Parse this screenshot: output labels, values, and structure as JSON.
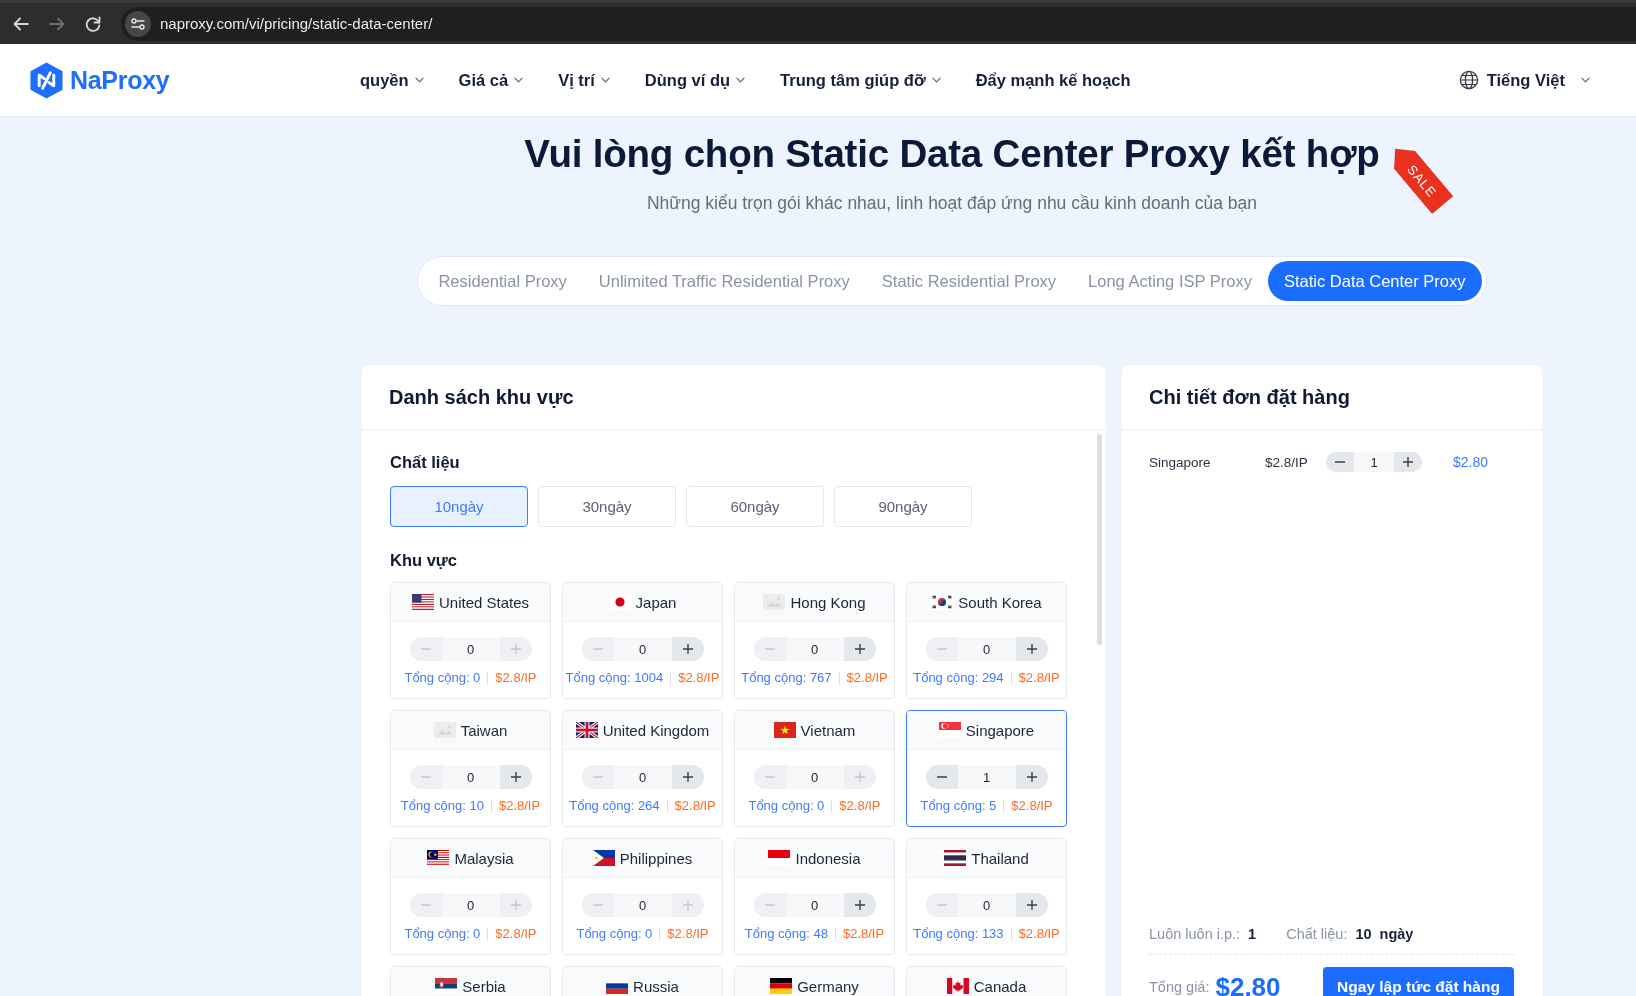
{
  "browser": {
    "nav_buttons": [
      {
        "kind": "back",
        "disabled": false
      },
      {
        "kind": "forward",
        "disabled": true
      },
      {
        "kind": "reload",
        "disabled": false
      }
    ],
    "url": "naproxy.com/vi/pricing/static-data-center/"
  },
  "header": {
    "logo": "NaProxy",
    "menu": [
      {
        "label": "quyền",
        "dropdown": true
      },
      {
        "label": "Giá cả",
        "dropdown": true
      },
      {
        "label": "Vị trí",
        "dropdown": true
      },
      {
        "label": "Dùng ví dụ",
        "dropdown": true
      },
      {
        "label": "Trung tâm giúp đỡ",
        "dropdown": true
      },
      {
        "label": "Đẩy mạnh kế hoạch",
        "dropdown": false
      }
    ],
    "language": "Tiếng Việt"
  },
  "hero": {
    "title": "Vui lòng chọn Static Data Center Proxy kết hợp",
    "badge": "SALE",
    "subtitle": "Những kiểu trọn gói khác nhau, linh hoạt đáp ứng nhu cầu kinh doanh của bạn"
  },
  "product_tabs": [
    {
      "label": "Residential Proxy",
      "selected": false
    },
    {
      "label": "Unlimited Traffic Residential Proxy",
      "selected": false
    },
    {
      "label": "Static Residential Proxy",
      "selected": false
    },
    {
      "label": "Long Acting ISP Proxy",
      "selected": false
    },
    {
      "label": "Static Data Center Proxy",
      "selected": true
    }
  ],
  "region_panel": {
    "title": "Danh sách khu vực",
    "duration_label": "Chất liệu",
    "durations": [
      {
        "label": "10ngày",
        "selected": true
      },
      {
        "label": "30ngày",
        "selected": false
      },
      {
        "label": "60ngày",
        "selected": false
      },
      {
        "label": "90ngày",
        "selected": false
      }
    ],
    "region_label": "Khu vực",
    "regions": [
      {
        "name": "United States",
        "kind": "us",
        "selected": false,
        "quantity": "0",
        "minus_disabled": true,
        "plus_disabled": true,
        "total": "Tổng cộng: 0",
        "price": "$2.8/IP"
      },
      {
        "name": "Japan",
        "kind": "jp",
        "selected": false,
        "quantity": "0",
        "minus_disabled": true,
        "plus_disabled": false,
        "total": "Tổng cộng: 1004",
        "price": "$2.8/IP"
      },
      {
        "name": "Hong Kong",
        "kind": "placeholder",
        "selected": false,
        "quantity": "0",
        "minus_disabled": true,
        "plus_disabled": false,
        "total": "Tổng cộng: 767",
        "price": "$2.8/IP"
      },
      {
        "name": "South Korea",
        "kind": "kr",
        "selected": false,
        "quantity": "0",
        "minus_disabled": true,
        "plus_disabled": false,
        "total": "Tổng cộng: 294",
        "price": "$2.8/IP"
      },
      {
        "name": "Taiwan",
        "kind": "placeholder",
        "selected": false,
        "quantity": "0",
        "minus_disabled": true,
        "plus_disabled": false,
        "total": "Tổng cộng: 10",
        "price": "$2.8/IP"
      },
      {
        "name": "United Kingdom",
        "kind": "gb",
        "selected": false,
        "quantity": "0",
        "minus_disabled": true,
        "plus_disabled": false,
        "total": "Tổng cộng: 264",
        "price": "$2.8/IP"
      },
      {
        "name": "Vietnam",
        "kind": "vn",
        "selected": false,
        "quantity": "0",
        "minus_disabled": true,
        "plus_disabled": true,
        "total": "Tổng cộng: 0",
        "price": "$2.8/IP"
      },
      {
        "name": "Singapore",
        "kind": "sg",
        "selected": true,
        "quantity": "1",
        "minus_disabled": false,
        "plus_disabled": false,
        "total": "Tổng cộng: 5",
        "price": "$2.8/IP"
      },
      {
        "name": "Malaysia",
        "kind": "my",
        "selected": false,
        "quantity": "0",
        "minus_disabled": true,
        "plus_disabled": true,
        "total": "Tổng cộng: 0",
        "price": "$2.8/IP"
      },
      {
        "name": "Philippines",
        "kind": "ph",
        "selected": false,
        "quantity": "0",
        "minus_disabled": true,
        "plus_disabled": true,
        "total": "Tổng cộng: 0",
        "price": "$2.8/IP"
      },
      {
        "name": "Indonesia",
        "kind": "id",
        "selected": false,
        "quantity": "0",
        "minus_disabled": true,
        "plus_disabled": false,
        "total": "Tổng cộng: 48",
        "price": "$2.8/IP"
      },
      {
        "name": "Thailand",
        "kind": "th",
        "selected": false,
        "quantity": "0",
        "minus_disabled": true,
        "plus_disabled": false,
        "total": "Tổng cộng: 133",
        "price": "$2.8/IP"
      },
      {
        "name": "Serbia",
        "kind": "rs",
        "selected": false
      },
      {
        "name": "Russia",
        "kind": "ru",
        "selected": false
      },
      {
        "name": "Germany",
        "kind": "de",
        "selected": false
      },
      {
        "name": "Canada",
        "kind": "ca",
        "selected": false
      }
    ]
  },
  "order_panel": {
    "title": "Chi tiết đơn đặt hàng",
    "items": [
      {
        "name": "Singapore",
        "unit_price": "$2.8/IP",
        "quantity": "1",
        "minus_disabled": false,
        "plus_disabled": false,
        "subtotal": "$2.80"
      }
    ],
    "summary": [
      {
        "label": "Luôn luôn i.p.:",
        "value": "1"
      },
      {
        "label": "Chất liệu:",
        "value": "10",
        "unit": "ngày"
      }
    ],
    "total_label": "Tổng giá:",
    "total": "$2.80",
    "submit": "Ngay lập tức đặt hàng"
  }
}
